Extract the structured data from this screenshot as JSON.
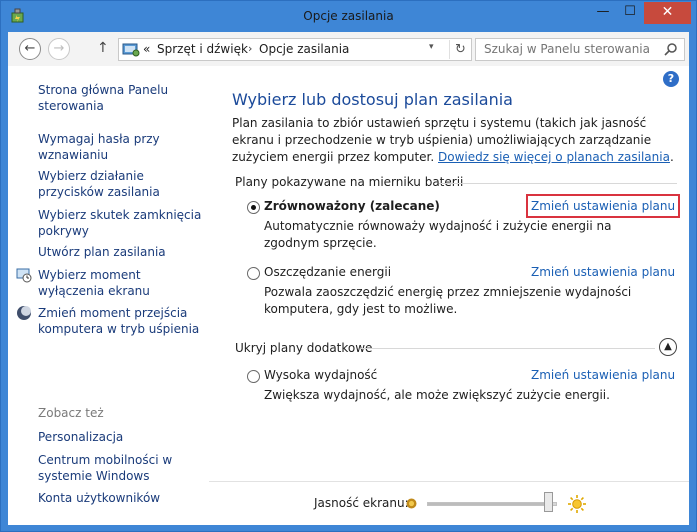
{
  "window": {
    "title": "Opcje zasilania",
    "controls": {
      "minimize": "—",
      "maximize": "☐",
      "close": "✕"
    }
  },
  "nav": {
    "back_icon": "back-arrow-icon",
    "forward_icon": "forward-arrow-icon",
    "up_icon": "up-arrow-icon",
    "breadcrumb": {
      "overflow": "«",
      "items": [
        "Sprzęt i dźwięk",
        "Opcje zasilania"
      ],
      "separator": "›"
    },
    "search_placeholder": "Szukaj w Panelu sterowania"
  },
  "sidebar": {
    "home": "Strona główna Panelu sterowania",
    "links": [
      "Wymagaj hasła przy wznawianiu",
      "Wybierz działanie przycisków zasilania",
      "Wybierz skutek zamknięcia pokrywy",
      "Utwórz plan zasilania",
      "Wybierz moment wyłączenia ekranu",
      "Zmień moment przejścia komputera w tryb uśpienia"
    ],
    "see_also": {
      "heading": "Zobacz też",
      "links": [
        "Personalizacja",
        "Centrum mobilności w systemie Windows",
        "Konta użytkowników"
      ]
    }
  },
  "main": {
    "help": "?",
    "title": "Wybierz lub dostosuj plan zasilania",
    "intro": "Plan zasilania to zbiór ustawień sprzętu i systemu (takich jak jasność ekranu i przechodzenie w tryb uśpienia) umożliwiających zarządzanie zużyciem energii przez komputer.",
    "intro_link": "Dowiedz się więcej o planach zasilania",
    "intro_end": ".",
    "group1_heading": "Plany pokazywane na mierniku baterii",
    "group2_heading": "Ukryj plany dodatkowe",
    "plans": [
      {
        "name": "Zrównoważony (zalecane)",
        "selected": true,
        "link": "Zmień ustawienia planu",
        "desc": "Automatycznie równoważy wydajność i zużycie energii na zgodnym sprzęcie."
      },
      {
        "name": "Oszczędzanie energii",
        "selected": false,
        "link": "Zmień ustawienia planu",
        "desc": "Pozwala zaoszczędzić energię przez zmniejszenie wydajności komputera, gdy jest to możliwe."
      },
      {
        "name": "Wysoka wydajność",
        "selected": false,
        "link": "Zmień ustawienia planu",
        "desc": "Zwiększa wydajność, ale może zwiększyć zużycie energii."
      }
    ],
    "brightness": {
      "label": "Jasność ekranu:",
      "level_percent": 97
    }
  },
  "colors": {
    "title_bar": "#3e86d6",
    "close_button": "#c74a3d",
    "link": "#1a5fb4",
    "heading": "#1b4a9a",
    "highlight_box": "#d9333f"
  }
}
